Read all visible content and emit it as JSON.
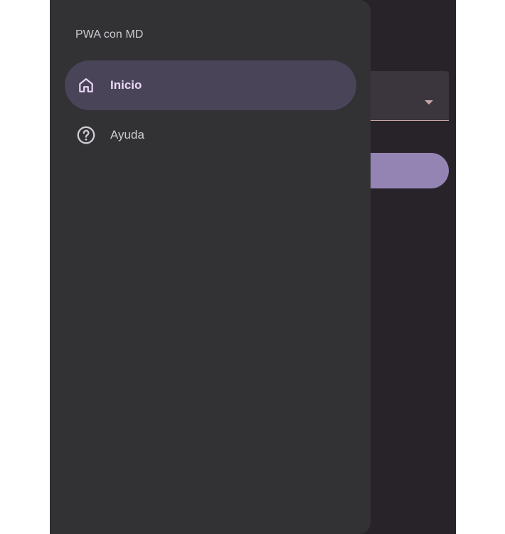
{
  "drawer": {
    "headline": "PWA con MD",
    "items": [
      {
        "label": "Inicio",
        "icon": "home-icon",
        "active": true
      },
      {
        "label": "Ayuda",
        "icon": "help-circle-icon",
        "active": false
      }
    ]
  },
  "colors": {
    "drawer_bg": "#323133",
    "active_indicator": "#4a4459",
    "active_text": "#ead8f7",
    "inactive_text": "#cfcbd3",
    "app_bg": "#272329",
    "button_bg": "#9484b4"
  }
}
